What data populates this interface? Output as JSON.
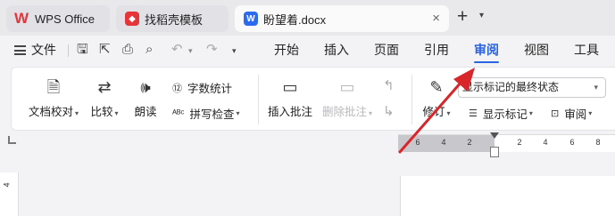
{
  "tabs": {
    "wps": "WPS Office",
    "template": "找稻壳模板",
    "doc": "盼望着.docx",
    "close": "×",
    "new": "+",
    "new_menu": "⌄"
  },
  "menu": {
    "file": "文件",
    "items": [
      "开始",
      "插入",
      "页面",
      "引用",
      "审阅",
      "视图",
      "工具"
    ],
    "active_index": 4
  },
  "ribbon": {
    "proofread": "文档校对",
    "compare": "比较",
    "read_aloud": "朗读",
    "word_count": "字数统计",
    "spell_check": "拼写检查",
    "insert_comment": "插入批注",
    "delete_comment": "删除批注",
    "revise": "修订",
    "show_markup_select": "显示标记的最终状态",
    "show_markup": "显示标记",
    "review": "审阅"
  },
  "ruler": {
    "ticks": [
      "6",
      "4",
      "2",
      "2",
      "4",
      "6",
      "8"
    ],
    "vertical": "4"
  },
  "colors": {
    "accent": "#2a63e0",
    "annotation_arrow": "#d8262a"
  },
  "icons": {
    "wps_logo": "wps-logo-icon",
    "template": "template-icon",
    "word_doc": "word-doc-icon"
  }
}
